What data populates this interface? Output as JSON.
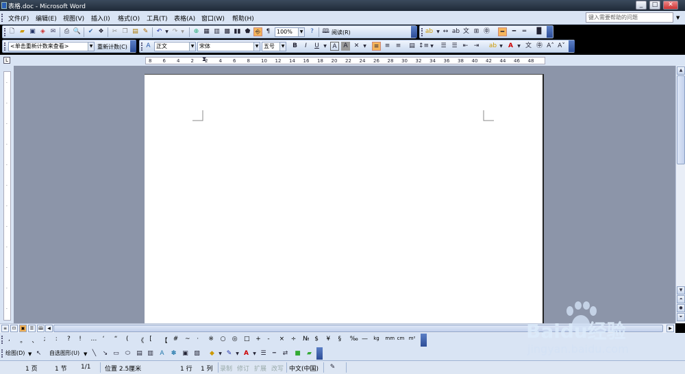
{
  "window": {
    "title": "表格.doc - Microsoft Word"
  },
  "menubar": {
    "items": [
      "文件(F)",
      "编辑(E)",
      "视图(V)",
      "插入(I)",
      "格式(O)",
      "工具(T)",
      "表格(A)",
      "窗口(W)",
      "帮助(H)"
    ],
    "help_placeholder": "键入需要帮助的问题"
  },
  "standard_toolbar": {
    "zoom": "100%",
    "read_label": "阅读(R)"
  },
  "formatting_toolbar": {
    "recount_placeholder": "<单击重新计数来查看>",
    "recount_button": "重新计数(C)",
    "style": "正文",
    "font": "宋体",
    "size": "五号"
  },
  "ruler": {
    "numbers": [
      "8",
      "6",
      "4",
      "2",
      "2",
      "4",
      "6",
      "8",
      "10",
      "12",
      "14",
      "16",
      "18",
      "20",
      "22",
      "24",
      "26",
      "28",
      "30",
      "32",
      "34",
      "36",
      "38",
      "40",
      "42",
      "44",
      "46",
      "48"
    ]
  },
  "symbol_bar": {
    "symbols": [
      ",",
      "。",
      "、",
      ";",
      ":",
      "?",
      "!",
      "…",
      "‘",
      "“",
      "(",
      "《",
      "[",
      "【",
      "#",
      "~",
      "·",
      "※",
      "○",
      "◎",
      "□",
      "+",
      "-",
      "×",
      "÷",
      "№",
      "$",
      "¥",
      "§",
      "‰",
      "—",
      "kg",
      "mm",
      "cm",
      "m²"
    ]
  },
  "drawing_toolbar": {
    "draw_label": "绘图(D)",
    "autoshape_label": "自选图形(U)"
  },
  "statusbar": {
    "page": "1 页",
    "section": "1 节",
    "page_of": "1/1",
    "position": "位置 2.5厘米",
    "line": "1 行",
    "column": "1 列",
    "rec": "录制",
    "trk": "修订",
    "ext": "扩展",
    "ovr": "改写",
    "language": "中文(中国)"
  },
  "watermark": {
    "brand": "Baidu经验",
    "url": "jingyan.baidu.com"
  },
  "colors": {
    "accent": "#f5a623",
    "toolbar_bg": "#d9e4f4",
    "doc_bg": "#8c95a9"
  }
}
